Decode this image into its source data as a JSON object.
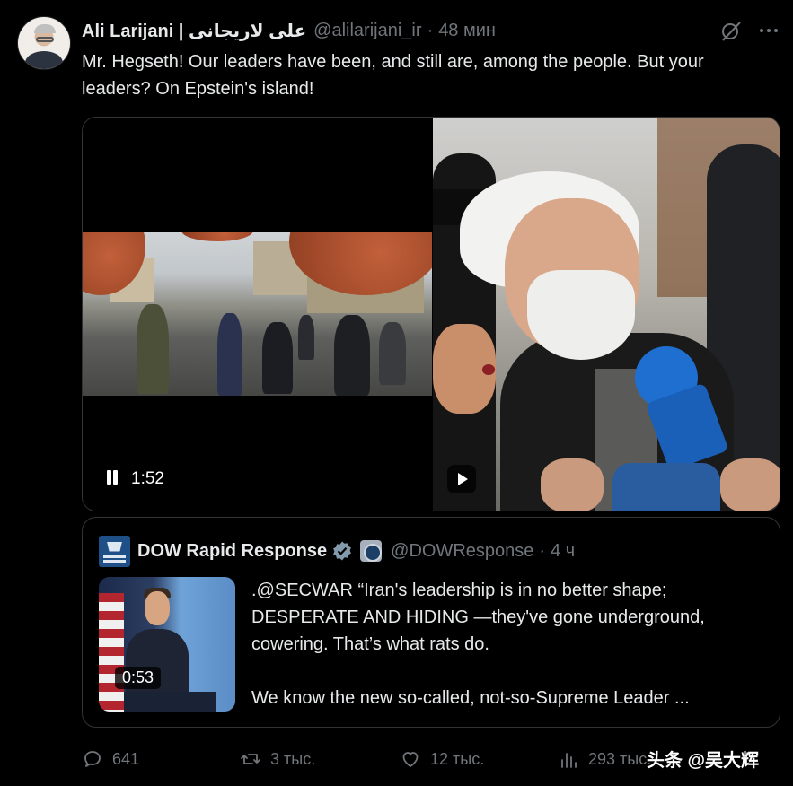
{
  "tweet": {
    "author_name": "Ali Larijani | علی لاریجانی",
    "author_handle": "@alilarijani_ir",
    "separator": "·",
    "time": "48 мин",
    "text": "Mr. Hegseth! Our leaders have been, and still are, among the people. But your leaders? On Epstein's island!"
  },
  "media": {
    "video_time": "1:52"
  },
  "quote": {
    "name": "DOW Rapid Response",
    "handle": "@DOWResponse",
    "separator": "·",
    "time": "4 ч",
    "thumb_duration": "0:53",
    "text": ".@SECWAR “Iran's leadership is in no better shape; DESPERATE AND HIDING —they've gone underground, cowering. That’s what rats do.\n\nWe know the new so-called, not-so-Supreme Leader ..."
  },
  "actions": {
    "replies": "641",
    "reposts": "3 тыс.",
    "likes": "12 тыс.",
    "views": "293 тыс."
  },
  "icons": [
    "grok-icon",
    "more-icon",
    "pause-icon",
    "play-icon",
    "verified-icon",
    "seal-icon",
    "reply-icon",
    "repost-icon",
    "like-icon",
    "views-icon"
  ],
  "watermark": "头条 @吴大辉",
  "colors": {
    "background": "#000000",
    "text": "#e7e9ea",
    "muted": "#71767b",
    "verified": "#829aab",
    "border": "#333333"
  }
}
